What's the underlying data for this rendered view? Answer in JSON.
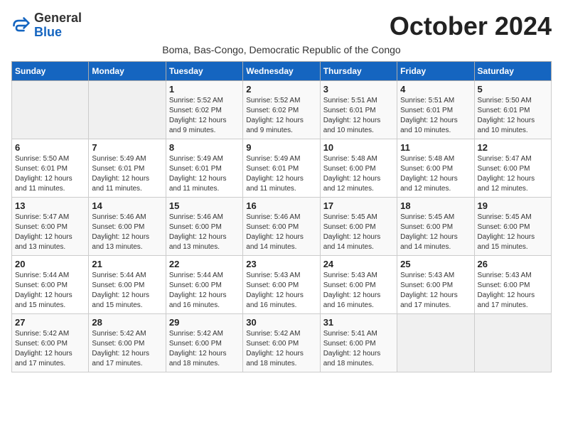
{
  "logo": {
    "general": "General",
    "blue": "Blue"
  },
  "title": "October 2024",
  "subtitle": "Boma, Bas-Congo, Democratic Republic of the Congo",
  "header": {
    "days": [
      "Sunday",
      "Monday",
      "Tuesday",
      "Wednesday",
      "Thursday",
      "Friday",
      "Saturday"
    ]
  },
  "weeks": [
    [
      {
        "num": "",
        "info": ""
      },
      {
        "num": "",
        "info": ""
      },
      {
        "num": "1",
        "info": "Sunrise: 5:52 AM\nSunset: 6:02 PM\nDaylight: 12 hours and 9 minutes."
      },
      {
        "num": "2",
        "info": "Sunrise: 5:52 AM\nSunset: 6:02 PM\nDaylight: 12 hours and 9 minutes."
      },
      {
        "num": "3",
        "info": "Sunrise: 5:51 AM\nSunset: 6:01 PM\nDaylight: 12 hours and 10 minutes."
      },
      {
        "num": "4",
        "info": "Sunrise: 5:51 AM\nSunset: 6:01 PM\nDaylight: 12 hours and 10 minutes."
      },
      {
        "num": "5",
        "info": "Sunrise: 5:50 AM\nSunset: 6:01 PM\nDaylight: 12 hours and 10 minutes."
      }
    ],
    [
      {
        "num": "6",
        "info": "Sunrise: 5:50 AM\nSunset: 6:01 PM\nDaylight: 12 hours and 11 minutes."
      },
      {
        "num": "7",
        "info": "Sunrise: 5:49 AM\nSunset: 6:01 PM\nDaylight: 12 hours and 11 minutes."
      },
      {
        "num": "8",
        "info": "Sunrise: 5:49 AM\nSunset: 6:01 PM\nDaylight: 12 hours and 11 minutes."
      },
      {
        "num": "9",
        "info": "Sunrise: 5:49 AM\nSunset: 6:01 PM\nDaylight: 12 hours and 11 minutes."
      },
      {
        "num": "10",
        "info": "Sunrise: 5:48 AM\nSunset: 6:00 PM\nDaylight: 12 hours and 12 minutes."
      },
      {
        "num": "11",
        "info": "Sunrise: 5:48 AM\nSunset: 6:00 PM\nDaylight: 12 hours and 12 minutes."
      },
      {
        "num": "12",
        "info": "Sunrise: 5:47 AM\nSunset: 6:00 PM\nDaylight: 12 hours and 12 minutes."
      }
    ],
    [
      {
        "num": "13",
        "info": "Sunrise: 5:47 AM\nSunset: 6:00 PM\nDaylight: 12 hours and 13 minutes."
      },
      {
        "num": "14",
        "info": "Sunrise: 5:46 AM\nSunset: 6:00 PM\nDaylight: 12 hours and 13 minutes."
      },
      {
        "num": "15",
        "info": "Sunrise: 5:46 AM\nSunset: 6:00 PM\nDaylight: 12 hours and 13 minutes."
      },
      {
        "num": "16",
        "info": "Sunrise: 5:46 AM\nSunset: 6:00 PM\nDaylight: 12 hours and 14 minutes."
      },
      {
        "num": "17",
        "info": "Sunrise: 5:45 AM\nSunset: 6:00 PM\nDaylight: 12 hours and 14 minutes."
      },
      {
        "num": "18",
        "info": "Sunrise: 5:45 AM\nSunset: 6:00 PM\nDaylight: 12 hours and 14 minutes."
      },
      {
        "num": "19",
        "info": "Sunrise: 5:45 AM\nSunset: 6:00 PM\nDaylight: 12 hours and 15 minutes."
      }
    ],
    [
      {
        "num": "20",
        "info": "Sunrise: 5:44 AM\nSunset: 6:00 PM\nDaylight: 12 hours and 15 minutes."
      },
      {
        "num": "21",
        "info": "Sunrise: 5:44 AM\nSunset: 6:00 PM\nDaylight: 12 hours and 15 minutes."
      },
      {
        "num": "22",
        "info": "Sunrise: 5:44 AM\nSunset: 6:00 PM\nDaylight: 12 hours and 16 minutes."
      },
      {
        "num": "23",
        "info": "Sunrise: 5:43 AM\nSunset: 6:00 PM\nDaylight: 12 hours and 16 minutes."
      },
      {
        "num": "24",
        "info": "Sunrise: 5:43 AM\nSunset: 6:00 PM\nDaylight: 12 hours and 16 minutes."
      },
      {
        "num": "25",
        "info": "Sunrise: 5:43 AM\nSunset: 6:00 PM\nDaylight: 12 hours and 17 minutes."
      },
      {
        "num": "26",
        "info": "Sunrise: 5:43 AM\nSunset: 6:00 PM\nDaylight: 12 hours and 17 minutes."
      }
    ],
    [
      {
        "num": "27",
        "info": "Sunrise: 5:42 AM\nSunset: 6:00 PM\nDaylight: 12 hours and 17 minutes."
      },
      {
        "num": "28",
        "info": "Sunrise: 5:42 AM\nSunset: 6:00 PM\nDaylight: 12 hours and 17 minutes."
      },
      {
        "num": "29",
        "info": "Sunrise: 5:42 AM\nSunset: 6:00 PM\nDaylight: 12 hours and 18 minutes."
      },
      {
        "num": "30",
        "info": "Sunrise: 5:42 AM\nSunset: 6:00 PM\nDaylight: 12 hours and 18 minutes."
      },
      {
        "num": "31",
        "info": "Sunrise: 5:41 AM\nSunset: 6:00 PM\nDaylight: 12 hours and 18 minutes."
      },
      {
        "num": "",
        "info": ""
      },
      {
        "num": "",
        "info": ""
      }
    ]
  ]
}
